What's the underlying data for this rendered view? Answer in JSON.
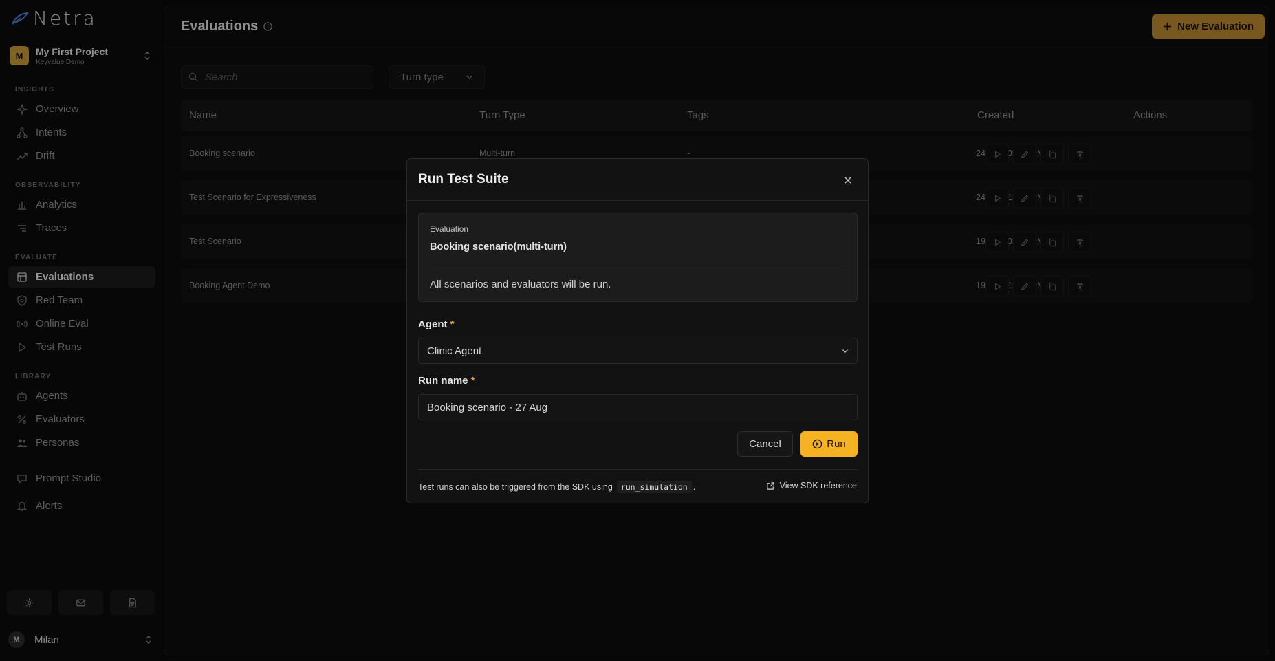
{
  "app": {
    "logo_text": "Netra"
  },
  "project": {
    "avatar": "M",
    "name": "My First Project",
    "subtitle": "Keyvalue Demo"
  },
  "sidebar": {
    "sections": {
      "insights": "INSIGHTS",
      "observability": "OBSERVABILITY",
      "evaluate": "EVALUATE",
      "library": "LIBRARY"
    },
    "items": [
      {
        "label": "Overview",
        "icon": "sparkle-icon"
      },
      {
        "label": "Intents",
        "icon": "network-icon"
      },
      {
        "label": "Drift",
        "icon": "trend-icon"
      },
      {
        "label": "Analytics",
        "icon": "bar-chart-icon"
      },
      {
        "label": "Traces",
        "icon": "list-icon"
      },
      {
        "label": "Evaluations",
        "icon": "grid-icon",
        "active": true
      },
      {
        "label": "Red Team",
        "icon": "shield-icon"
      },
      {
        "label": "Online Eval",
        "icon": "broadcast-icon"
      },
      {
        "label": "Test Runs",
        "icon": "play-icon"
      },
      {
        "label": "Agents",
        "icon": "bot-icon"
      },
      {
        "label": "Evaluators",
        "icon": "percent-icon"
      },
      {
        "label": "Personas",
        "icon": "users-icon"
      },
      {
        "label": "Prompt Studio",
        "icon": "chat-icon"
      },
      {
        "label": "Alerts",
        "icon": "bell-icon"
      }
    ]
  },
  "user": {
    "avatar": "M",
    "name": "Milan"
  },
  "page": {
    "title": "Evaluations",
    "new_button": "New Evaluation",
    "search_placeholder": "Search",
    "turn_filter": "Turn type"
  },
  "table": {
    "columns": [
      "Name",
      "Turn Type",
      "Tags",
      "Created",
      "Actions"
    ],
    "rows": [
      {
        "name": "Booking scenario",
        "turn": "Multi-turn",
        "tags": "-",
        "created": "24 Aug, 05:36 PM"
      },
      {
        "name": "Test Scenario for Expressiveness",
        "turn": "",
        "tags": "",
        "created": "24 Aug, 12:30 PM"
      },
      {
        "name": "Test Scenario",
        "turn": "",
        "tags": "",
        "created": "19 Aug, 03:58 PM"
      },
      {
        "name": "Booking Agent Demo",
        "turn": "",
        "tags": "",
        "created": "19 Aug, 12:32 PM"
      }
    ]
  },
  "modal": {
    "title": "Run Test Suite",
    "eval_label": "Evaluation",
    "eval_name": "Booking scenario(multi-turn)",
    "eval_note": "All scenarios and evaluators will be run.",
    "agent_label": "Agent",
    "agent_value": "Clinic Agent",
    "run_name_label": "Run name",
    "run_name_value": "Booking scenario - 27 Aug",
    "required_mark": "*",
    "cancel_label": "Cancel",
    "run_label": "Run",
    "footer_text": "Test runs can also be triggered from the SDK using",
    "footer_code": "run_simulation",
    "footer_period": ".",
    "sdk_link": "View SDK reference"
  },
  "colors": {
    "accent": "#f5b324",
    "accent_muted": "#b9882f",
    "required": "#e0a033"
  }
}
